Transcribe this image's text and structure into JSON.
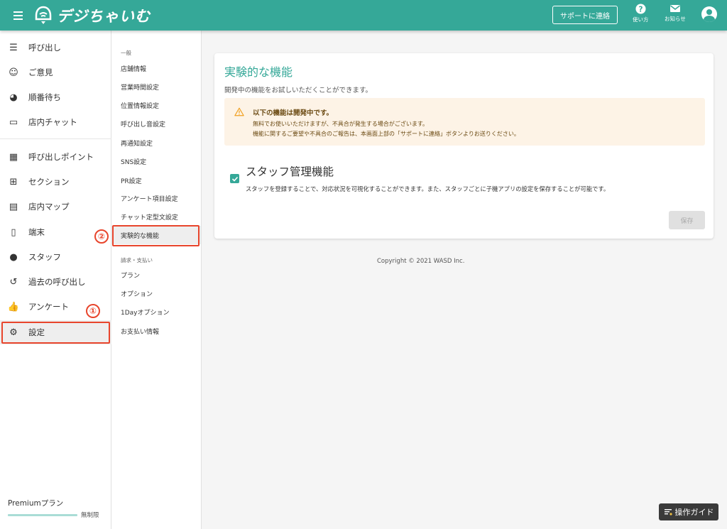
{
  "header": {
    "app_name": "デジちゃいむ",
    "support_label": "サポートに連絡",
    "help_label": "使い方",
    "notice_label": "お知らせ",
    "accent": "#35a898"
  },
  "sidebar": {
    "items": [
      {
        "label": "呼び出し",
        "icon": "list-icon"
      },
      {
        "label": "ご意見",
        "icon": "feedback-icon"
      },
      {
        "label": "順番待ち",
        "icon": "queue-icon"
      },
      {
        "label": "店内チャット",
        "icon": "chat-icon"
      },
      {
        "label": "呼び出しポイント",
        "icon": "qr-code-icon"
      },
      {
        "label": "セクション",
        "icon": "section-icon"
      },
      {
        "label": "店内マップ",
        "icon": "map-icon"
      },
      {
        "label": "端末",
        "icon": "phone-icon"
      },
      {
        "label": "スタッフ",
        "icon": "staff-icon"
      },
      {
        "label": "過去の呼び出し",
        "icon": "history-icon"
      },
      {
        "label": "アンケート",
        "icon": "thumb-up-icon"
      },
      {
        "label": "設定",
        "icon": "gear-icon"
      }
    ],
    "plan_label": "Premiumプラン",
    "plan_limit": "無制限",
    "plan_usage_fraction": 1.0
  },
  "submenu": {
    "section1": "一般",
    "items1": [
      "店舗情報",
      "営業時間設定",
      "位置情報設定",
      "呼び出し音設定",
      "再通知設定",
      "SNS設定",
      "PR設定",
      "アンケート項目設定",
      "チャット定型文設定",
      "実験的な機能"
    ],
    "section2": "請求・支払い",
    "items2": [
      "プラン",
      "オプション",
      "1Dayオプション",
      "お支払い情報"
    ]
  },
  "annotations": {
    "badge1": "①",
    "badge2": "②"
  },
  "main": {
    "title": "実験的な機能",
    "description": "開発中の機能をお試しいただくことができます。",
    "alert_title": "以下の機能は開発中です。",
    "alert_line1": "無料でお使いいただけますが、不具合が発生する場合がございます。",
    "alert_line2": "機能に関するご要望や不具合のご報告は、本画面上部の「サポートに連絡」ボタンよりお送りください。",
    "feature_title": "スタッフ管理機能",
    "feature_desc": "スタッフを登録することで、対応状況を可視化することができます。また、スタッフごとに子機アプリの設定を保存することが可能です。",
    "feature_checked": true,
    "save_label": "保存"
  },
  "footer": {
    "copyright": "Copyright © 2021 WASD Inc.",
    "guide_label": "操作ガイド"
  }
}
